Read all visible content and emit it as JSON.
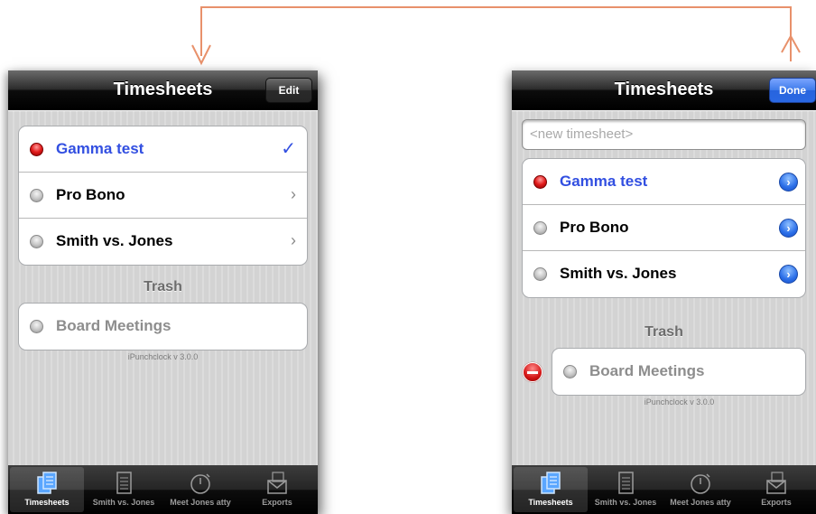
{
  "left_screen": {
    "title": "Timesheets",
    "nav_button": "Edit",
    "rows": [
      {
        "label": "Gamma test",
        "active": true,
        "accessory": "✓"
      },
      {
        "label": "Pro Bono",
        "active": false,
        "accessory": "›"
      },
      {
        "label": "Smith vs. Jones",
        "active": false,
        "accessory": "›"
      }
    ],
    "trash_header": "Trash",
    "trash_rows": [
      {
        "label": "Board Meetings"
      }
    ],
    "version": "iPunchclock v 3.0.0"
  },
  "right_screen": {
    "title": "Timesheets",
    "nav_button": "Done",
    "new_placeholder": "<new timesheet>",
    "rows": [
      {
        "label": "Gamma test",
        "active": true
      },
      {
        "label": "Pro Bono",
        "active": false
      },
      {
        "label": "Smith vs. Jones",
        "active": false
      }
    ],
    "trash_header": "Trash",
    "trash_rows": [
      {
        "label": "Board Meetings"
      }
    ],
    "version": "iPunchclock v 3.0.0"
  },
  "tabbar": {
    "tabs": [
      {
        "label": "Timesheets",
        "icon": "timesheets-icon",
        "selected": true
      },
      {
        "label": "Smith vs. Jones",
        "icon": "document-icon",
        "selected": false
      },
      {
        "label": "Meet Jones atty",
        "icon": "stopwatch-icon",
        "selected": false
      },
      {
        "label": "Exports",
        "icon": "export-icon",
        "selected": false
      }
    ]
  },
  "colors": {
    "arrow": "#e8916b",
    "active_text": "#324fe1",
    "done_button": "#2a68e3"
  }
}
